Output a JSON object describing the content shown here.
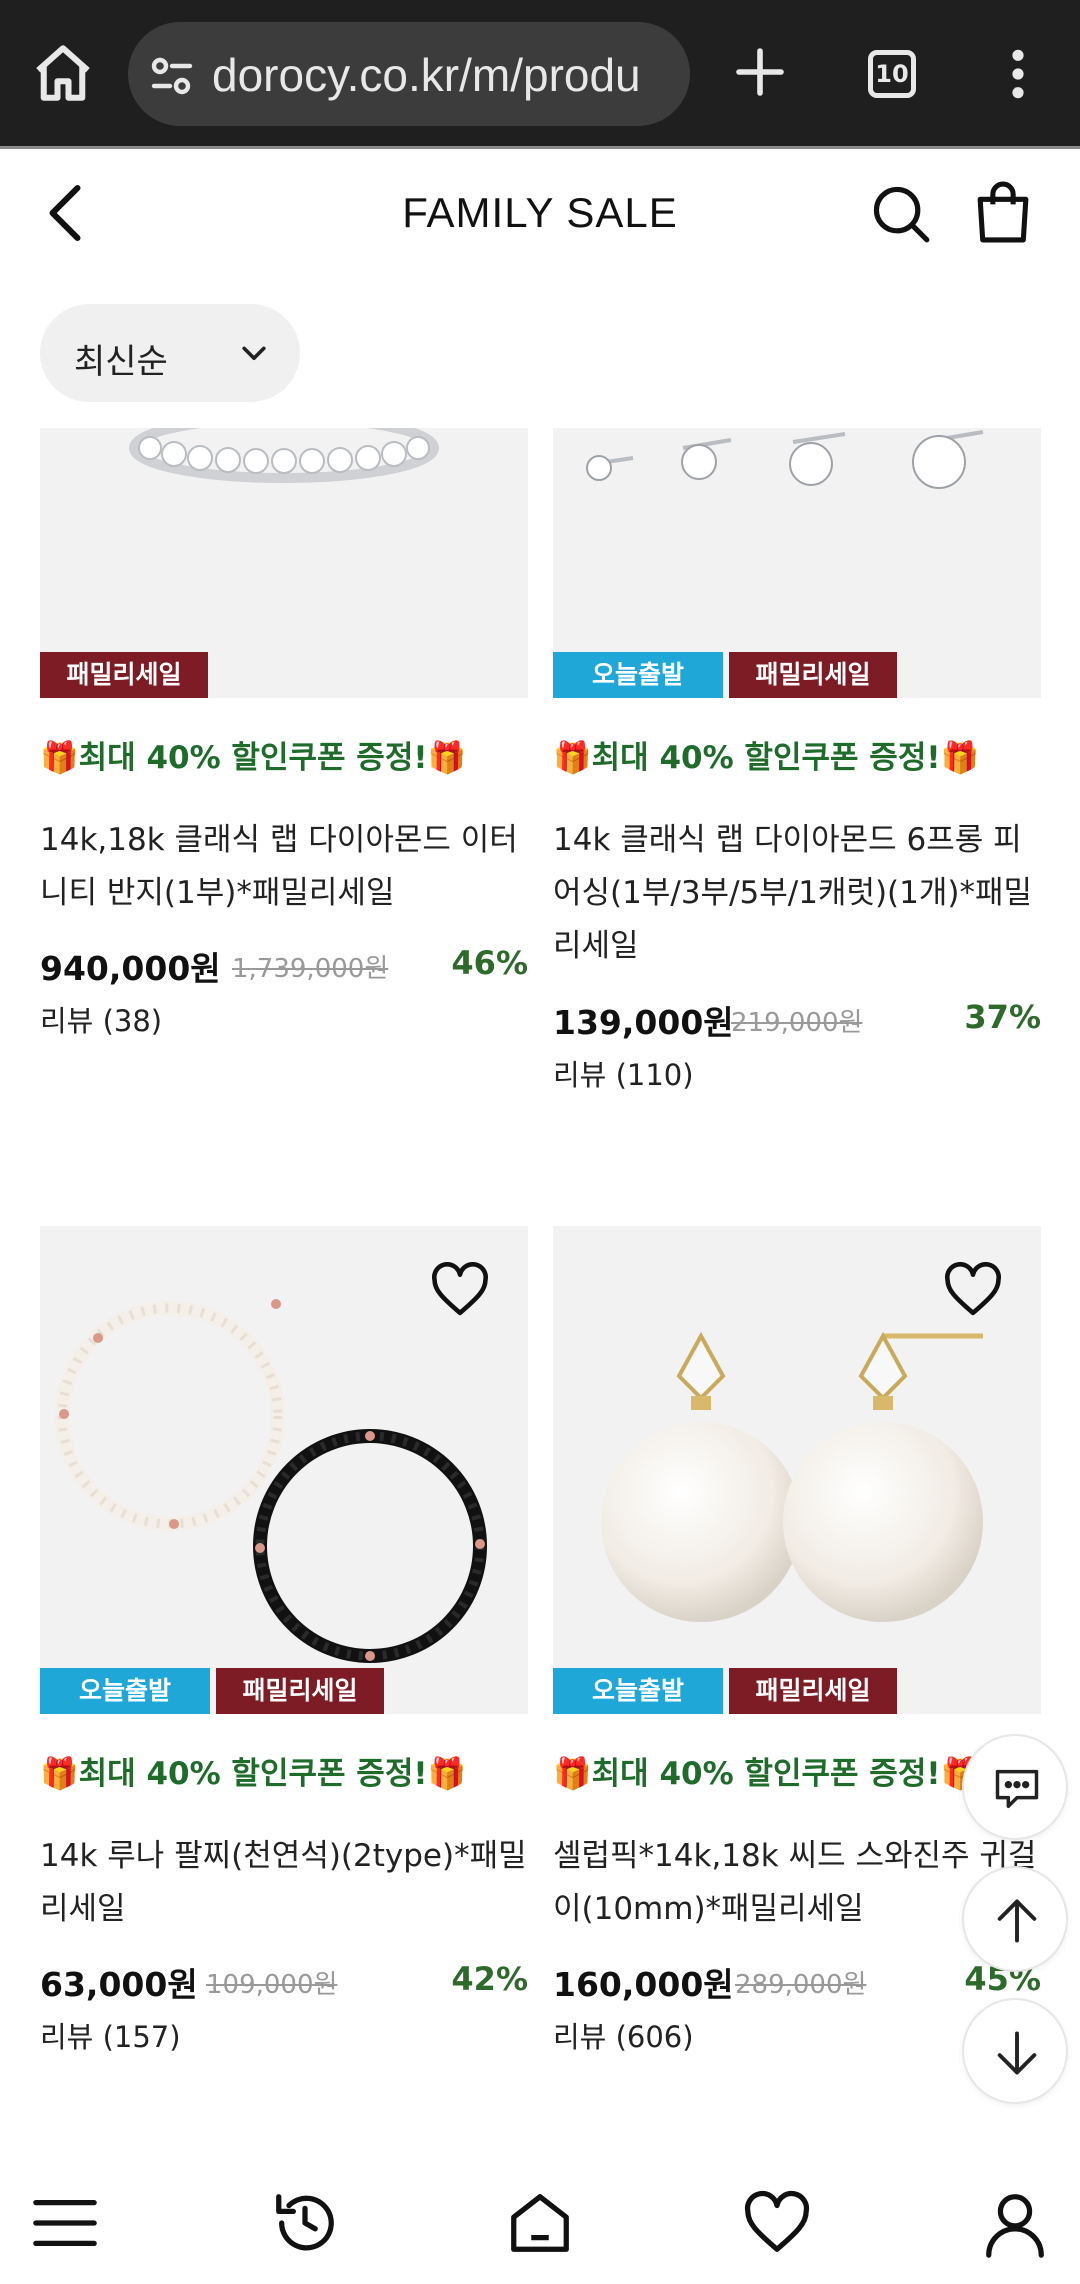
{
  "browser": {
    "url": "dorocy.co.kr/m/produ",
    "tab_count": "10",
    "icons": [
      "home-icon",
      "site-settings-icon",
      "new-tab-icon",
      "tab-switcher-icon",
      "more-vert-icon"
    ]
  },
  "header": {
    "title": "FAMILY SALE",
    "icons": [
      "back-icon",
      "search-icon",
      "bag-icon"
    ]
  },
  "sort": {
    "label": "최신순"
  },
  "products": [
    {
      "badges": [
        "패밀리세일"
      ],
      "promo": "최대 40% 할인쿠폰 증정!",
      "name": "14k,18k 클래식 랩 다이아몬드 이터니티 반지(1부)*패밀리세일",
      "price": "940,000원",
      "original_price": "1,739,000원",
      "discount": "46%",
      "review": "리뷰 (38)"
    },
    {
      "badges": [
        "오늘출발",
        "패밀리세일"
      ],
      "promo": "최대 40% 할인쿠폰 증정!",
      "name": "14k 클래식 랩 다이아몬드 6프롱 피어싱(1부/3부/5부/1캐럿)(1개)*패밀리세일",
      "price": "139,000원",
      "original_price": "219,000원",
      "discount": "37%",
      "review": "리뷰 (110)"
    },
    {
      "badges": [
        "오늘출발",
        "패밀리세일"
      ],
      "promo": "최대 40% 할인쿠폰 증정!",
      "name": "14k 루나 팔찌(천연석)(2type)*패밀리세일",
      "price": "63,000원",
      "original_price": "109,000원",
      "discount": "42%",
      "review": "리뷰 (157)"
    },
    {
      "badges": [
        "오늘출발",
        "패밀리세일"
      ],
      "promo": "최대 40% 할인쿠폰 증정!",
      "name": "셀럽픽*14k,18k 씨드 스와진주 귀걸이(10mm)*패밀리세일",
      "price": "160,000원",
      "original_price": "289,000원",
      "discount": "45%",
      "review": "리뷰 (606)"
    }
  ],
  "floating": [
    "chat-icon",
    "scroll-top-icon",
    "scroll-bottom-icon"
  ],
  "bottom_nav": [
    "menu-icon",
    "history-icon",
    "home-icon",
    "wishlist-icon",
    "account-icon"
  ],
  "colors": {
    "ship_badge": "#1fa7d8",
    "family_badge": "#7d1c24",
    "promo_text": "#1e6b2a",
    "discount_text": "#2e6a2a",
    "browser_bg": "#1f1f1f"
  }
}
